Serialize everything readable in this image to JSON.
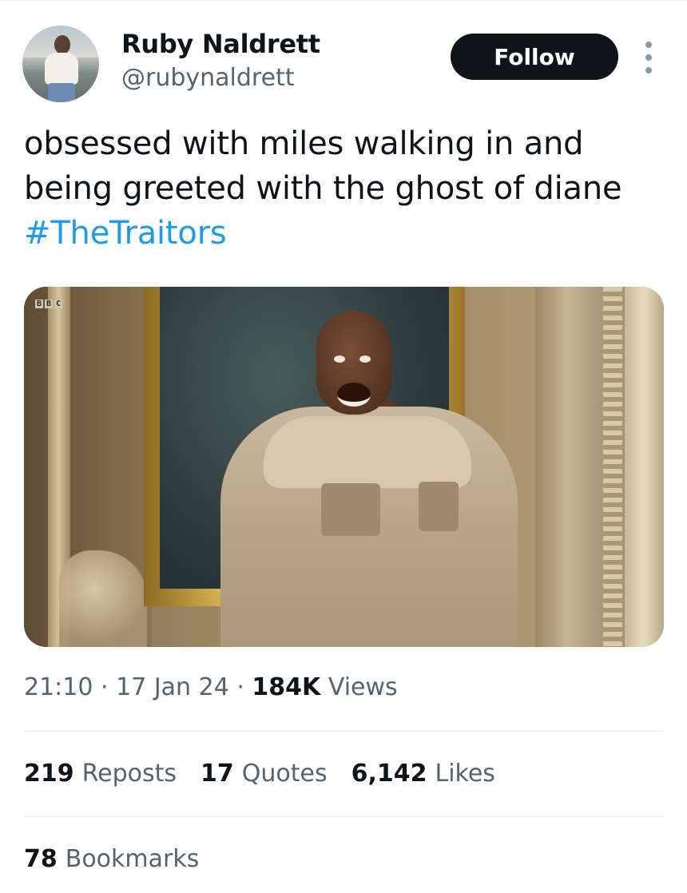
{
  "author": {
    "name": "Ruby Naldrett",
    "handle": "@rubynaldrett",
    "follow_label": "Follow"
  },
  "tweet": {
    "text_lines": [
      "obsessed with miles walking in and",
      "being greeted with the ghost of diane"
    ],
    "hashtag": "#TheTraitors"
  },
  "media": {
    "watermark": [
      "B",
      "B",
      "C"
    ]
  },
  "meta": {
    "time": "21:10",
    "separator": "·",
    "date": "17 Jan 24",
    "views_count": "184K",
    "views_label": "Views"
  },
  "stats": [
    {
      "count": "219",
      "label": "Reposts"
    },
    {
      "count": "17",
      "label": "Quotes"
    },
    {
      "count": "6,142",
      "label": "Likes"
    }
  ],
  "bookmarks": {
    "count": "78",
    "label": "Bookmarks"
  },
  "colors": {
    "link": "#1d9bf0",
    "secondary_text": "#536471",
    "primary_text": "#0f1419",
    "button_bg": "#0f1419"
  },
  "icons": {
    "more": "more-dots-icon"
  }
}
